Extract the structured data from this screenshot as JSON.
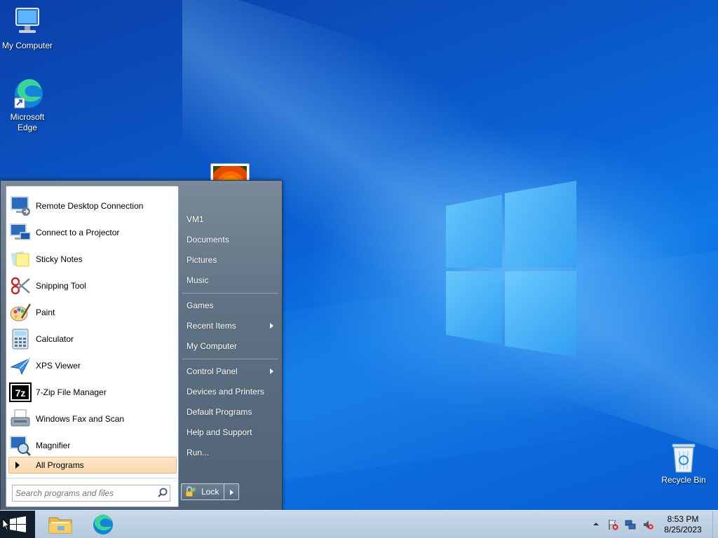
{
  "desktop": {
    "icons": [
      {
        "label": "My Computer",
        "icon": "computer-icon"
      },
      {
        "label": "Microsoft Edge",
        "icon": "edge-icon"
      },
      {
        "label": "Recycle Bin",
        "icon": "recycle-bin-icon"
      }
    ]
  },
  "start_menu": {
    "programs": [
      {
        "label": "Remote Desktop Connection",
        "icon": "remote-desktop-icon"
      },
      {
        "label": "Connect to a Projector",
        "icon": "projector-icon"
      },
      {
        "label": "Sticky Notes",
        "icon": "sticky-notes-icon"
      },
      {
        "label": "Snipping Tool",
        "icon": "scissors-icon"
      },
      {
        "label": "Paint",
        "icon": "paint-palette-icon"
      },
      {
        "label": "Calculator",
        "icon": "calculator-icon"
      },
      {
        "label": "XPS Viewer",
        "icon": "xps-icon"
      },
      {
        "label": "7-Zip File Manager",
        "icon": "7zip-icon"
      },
      {
        "label": "Windows Fax and Scan",
        "icon": "fax-icon"
      },
      {
        "label": "Magnifier",
        "icon": "magnifier-icon"
      }
    ],
    "all_programs_label": "All Programs",
    "search_placeholder": "Search programs and files",
    "right_items": [
      {
        "label": "VM1",
        "submenu": false
      },
      {
        "label": "Documents",
        "submenu": false
      },
      {
        "label": "Pictures",
        "submenu": false
      },
      {
        "label": "Music",
        "submenu": false
      },
      {
        "label": "Games",
        "submenu": false
      },
      {
        "label": "Recent Items",
        "submenu": true
      },
      {
        "label": "My Computer",
        "submenu": false
      },
      {
        "label": "Control Panel",
        "submenu": true
      },
      {
        "label": "Devices and Printers",
        "submenu": false
      },
      {
        "label": "Default Programs",
        "submenu": false
      },
      {
        "label": "Help and Support",
        "submenu": false
      },
      {
        "label": "Run...",
        "submenu": false
      }
    ],
    "lock_label": "Lock"
  },
  "taskbar": {
    "pinned": [
      {
        "name": "File Explorer",
        "icon": "folder-icon"
      },
      {
        "name": "Microsoft Edge",
        "icon": "edge-icon"
      }
    ],
    "clock": {
      "time": "8:53 PM",
      "date": "8/25/2023"
    },
    "tray": [
      "show-hidden-icons-chevron",
      "action-center-flag-icon",
      "network-icon",
      "volume-muted-icon"
    ]
  },
  "colors": {
    "start_menu_frame": "#5f7183",
    "all_programs_highlight": "#fbd9b0",
    "taskbar": "#c9d9ea",
    "desktop": "#0a63d6"
  }
}
